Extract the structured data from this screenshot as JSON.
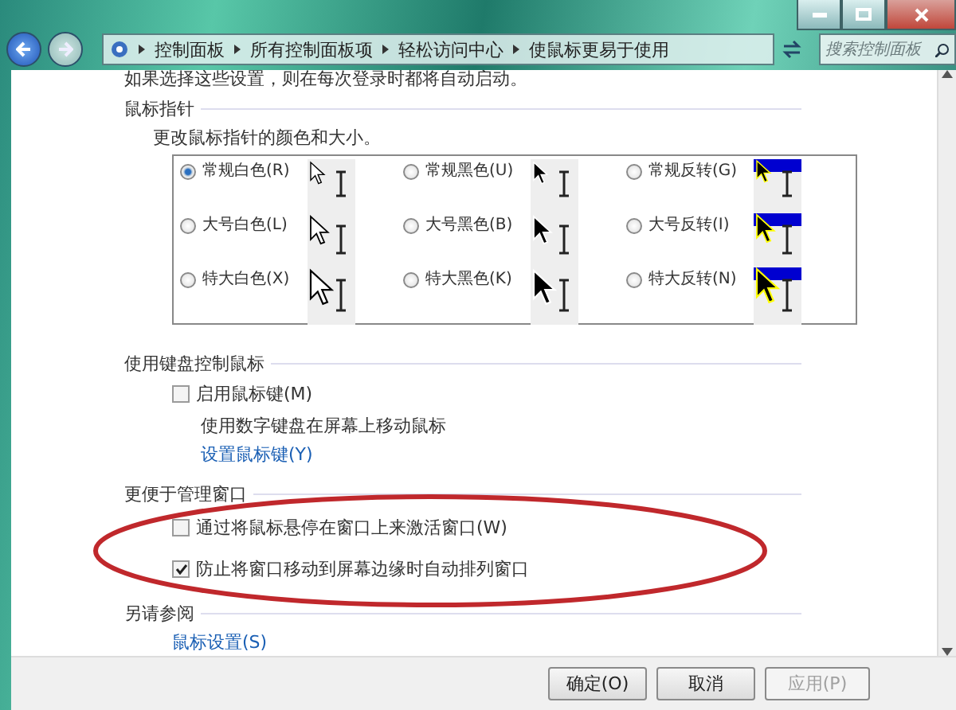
{
  "address_bar": {
    "crumbs": [
      "控制面板",
      "所有控制面板项",
      "轻松访问中心",
      "使鼠标更易于使用"
    ]
  },
  "search": {
    "placeholder": "搜索控制面板"
  },
  "intro": "如果选择这些设置，则在每次登录时都将自动启动。",
  "pointer_section": {
    "heading": "鼠标指针",
    "description": "更改鼠标指针的颜色和大小。",
    "options": [
      {
        "label": "常规白色(R)",
        "selected": true,
        "kind": "white"
      },
      {
        "label": "常规黑色(U)",
        "selected": false,
        "kind": "black"
      },
      {
        "label": "常规反转(G)",
        "selected": false,
        "kind": "inverted"
      },
      {
        "label": "大号白色(L)",
        "selected": false,
        "kind": "white"
      },
      {
        "label": "大号黑色(B)",
        "selected": false,
        "kind": "black"
      },
      {
        "label": "大号反转(I)",
        "selected": false,
        "kind": "inverted"
      },
      {
        "label": "特大白色(X)",
        "selected": false,
        "kind": "white"
      },
      {
        "label": "特大黑色(K)",
        "selected": false,
        "kind": "black"
      },
      {
        "label": "特大反转(N)",
        "selected": false,
        "kind": "inverted"
      }
    ]
  },
  "keyboard_section": {
    "heading": "使用键盘控制鼠标",
    "checkbox": {
      "label": "启用鼠标键(M)",
      "checked": false
    },
    "description": "使用数字键盘在屏幕上移动鼠标",
    "link": "设置鼠标键(Y)"
  },
  "window_section": {
    "heading": "更便于管理窗口",
    "checkboxes": [
      {
        "label": "通过将鼠标悬停在窗口上来激活窗口(W)",
        "checked": false
      },
      {
        "label": "防止将窗口移动到屏幕边缘时自动排列窗口",
        "checked": true
      }
    ]
  },
  "see_also": {
    "heading": "另请参阅",
    "link": "鼠标设置(S)"
  },
  "buttons": [
    {
      "label": "确定(O)",
      "disabled": false
    },
    {
      "label": "取消",
      "disabled": false
    },
    {
      "label": "应用(P)",
      "disabled": true
    }
  ]
}
